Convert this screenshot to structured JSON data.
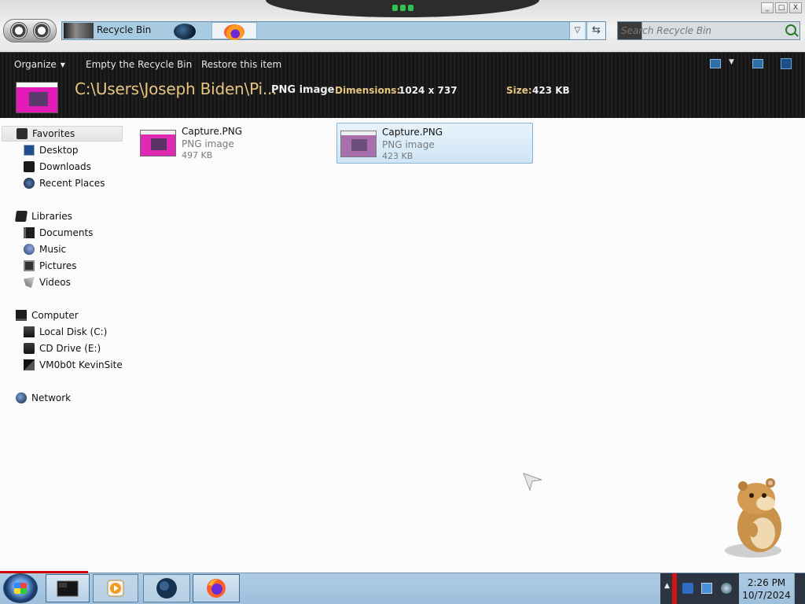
{
  "window": {
    "address_title": "Recycle Bin",
    "search_placeholder": "Search Recycle Bin",
    "controls": {
      "minimize": "_",
      "maximize": "□",
      "close": "X"
    }
  },
  "toolbar": {
    "organize": "Organize",
    "empty": "Empty the Recycle Bin",
    "restore": "Restore this item"
  },
  "details": {
    "path": "C:\\Users\\Joseph Biden\\Pi...",
    "kind": "PNG image",
    "dimensions_label": "Dimensions:",
    "dimensions_value": "1024 x 737",
    "size_label": "Size:",
    "size_value": "423 KB"
  },
  "sidebar": {
    "favorites": "Favorites",
    "desktop": "Desktop",
    "downloads": "Downloads",
    "recent": "Recent Places",
    "libraries": "Libraries",
    "documents": "Documents",
    "music": "Music",
    "pictures": "Pictures",
    "videos": "Videos",
    "computer": "Computer",
    "local_disk": "Local Disk (C:)",
    "cd_drive": "CD Drive (E:)",
    "share": "VM0b0t KevinSite",
    "network": "Network"
  },
  "files": [
    {
      "name": "Capture.PNG",
      "type": "PNG image",
      "size": "497 KB",
      "selected": false
    },
    {
      "name": "Capture.PNG",
      "type": "PNG image",
      "size": "423 KB",
      "selected": true
    }
  ],
  "taskbar": {
    "time": "2:26 PM",
    "date": "10/7/2024"
  },
  "colors": {
    "accent": "#e8c57e",
    "selection": "#cfe6f6",
    "taskbar": "#aecbe3"
  }
}
